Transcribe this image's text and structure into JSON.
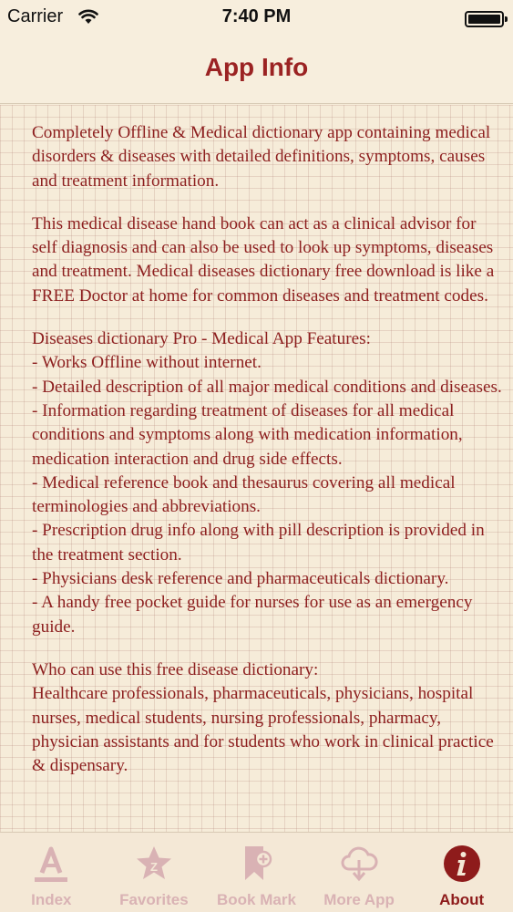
{
  "status_bar": {
    "carrier": "Carrier",
    "time": "7:40 PM"
  },
  "nav": {
    "title": "App Info"
  },
  "content": {
    "paragraphs": [
      "Completely Offline & Medical dictionary app containing medical disorders & diseases with detailed definitions, symptoms, causes and treatment information.",
      "This medical disease hand book can act as a clinical advisor for self diagnosis and can also be used to look up symptoms, diseases and treatment. Medical diseases dictionary free download is like a FREE Doctor at home for common diseases and treatment codes.",
      "Diseases dictionary Pro - Medical App Features:\n- Works Offline without internet.\n- Detailed description of all major medical conditions and diseases.\n- Information regarding treatment of diseases for all medical conditions and symptoms along with medication information, medication interaction and drug side effects.\n- Medical reference book and thesaurus covering all medical terminologies and abbreviations.\n- Prescription drug info along with pill description is provided in the treatment section.\n- Physicians desk reference and pharmaceuticals dictionary.\n- A handy free pocket guide for nurses for use as an emergency guide.",
      "Who can use this free disease dictionary:\nHealthcare professionals, pharmaceuticals, physicians, hospital nurses, medical students, nursing professionals, pharmacy, physician assistants and for students who work in clinical practice & dispensary."
    ]
  },
  "tabs": [
    {
      "label": "Index",
      "icon": "index-a-icon",
      "active": false
    },
    {
      "label": "Favorites",
      "icon": "star-icon",
      "active": false
    },
    {
      "label": "Book Mark",
      "icon": "bookmark-icon",
      "active": false
    },
    {
      "label": "More App",
      "icon": "cloud-download-icon",
      "active": false
    },
    {
      "label": "About",
      "icon": "info-icon",
      "active": true
    }
  ],
  "colors": {
    "accent": "#8e1b1b",
    "inactive": "#d9b2b4",
    "background": "#f6ecd9"
  }
}
